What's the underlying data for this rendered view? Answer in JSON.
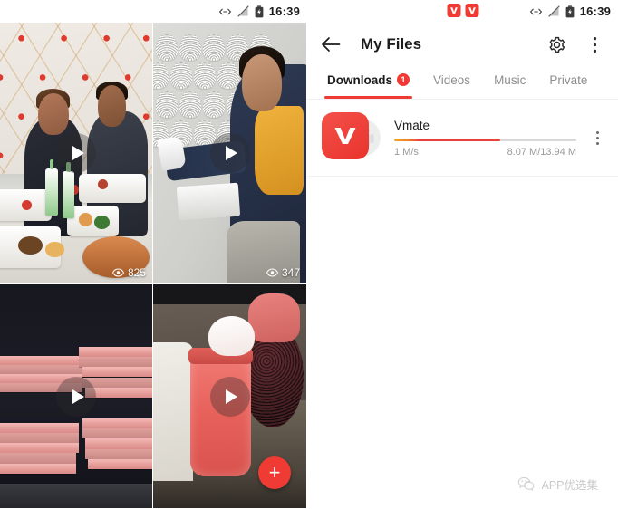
{
  "left_panel": {
    "statusbar": {
      "time": "16:39",
      "icons": [
        "usb-transfer-icon",
        "signal-off-icon",
        "battery-charging-icon"
      ]
    },
    "feed": {
      "tiles": [
        {
          "id": "tile-1",
          "description": "Two men eating at a table inside a decorated tent",
          "views": "825",
          "play_label": "play-icon"
        },
        {
          "id": "tile-2",
          "description": "Worker applying textured plaster to a wall",
          "views": "347",
          "play_label": "play-icon"
        },
        {
          "id": "tile-3",
          "description": "Stacks of pink sheet material",
          "views": "",
          "play_label": "play-icon"
        },
        {
          "id": "tile-4",
          "description": "Pink jar with whipped cream on a counter",
          "views": "",
          "play_label": "play-icon"
        }
      ]
    },
    "fab": {
      "label": "+",
      "name": "add-button",
      "color": "#ef3b33"
    }
  },
  "right_panel": {
    "statusbar": {
      "time": "16:39",
      "notification_icons": [
        "vmate-notification-icon",
        "vmate-notification-icon"
      ],
      "icons": [
        "usb-transfer-icon",
        "signal-off-icon",
        "battery-charging-icon"
      ]
    },
    "appbar": {
      "back_label": "back-arrow-icon",
      "title": "My Files",
      "settings_label": "gear-icon",
      "overflow_label": "more-vertical-icon"
    },
    "tabs": [
      {
        "label": "Downloads",
        "active": true,
        "badge": "1"
      },
      {
        "label": "Videos",
        "active": false,
        "badge": ""
      },
      {
        "label": "Music",
        "active": false,
        "badge": ""
      },
      {
        "label": "Private",
        "active": false,
        "badge": ""
      }
    ],
    "downloads": [
      {
        "name": "Vmate",
        "speed": "1 M/s",
        "size": "8.07 M/13.94 M",
        "progress_percent": 58,
        "icon": "vmate-app-icon",
        "menu": "more-vertical-icon"
      }
    ],
    "watermark": {
      "icon": "wechat-icon",
      "text": "APP优选集"
    }
  },
  "colors": {
    "accent_red": "#ef3b33",
    "progress_orange": "#f5a623",
    "progress_red": "#e8413e",
    "track_gray": "#d8d8d8",
    "text_primary": "#1c1c1c",
    "text_secondary": "#9a9a9a",
    "tab_inactive": "#8e8e8e"
  }
}
